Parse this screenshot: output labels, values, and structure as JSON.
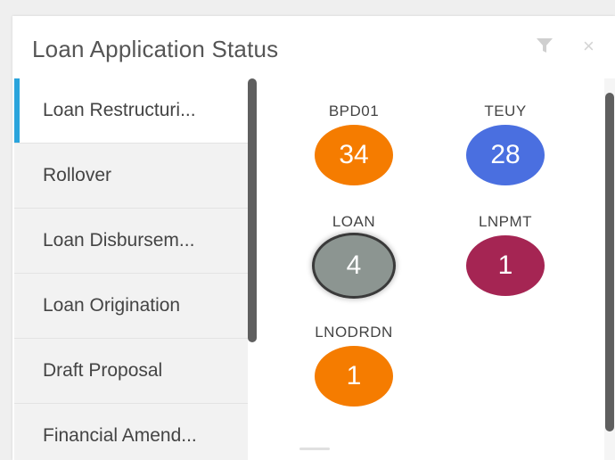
{
  "widget": {
    "title": "Loan Application Status",
    "filter_icon": "filter-icon",
    "close_icon": "close-icon",
    "close_glyph": "×"
  },
  "sidebar": {
    "items": [
      {
        "label": "Loan Restructuri...",
        "active": true
      },
      {
        "label": "Rollover",
        "active": false
      },
      {
        "label": "Loan Disbursem...",
        "active": false
      },
      {
        "label": "Loan Origination",
        "active": false
      },
      {
        "label": "Draft Proposal",
        "active": false
      },
      {
        "label": "Financial Amend...",
        "active": false
      }
    ]
  },
  "tiles": [
    {
      "code": "BPD01",
      "count": "34",
      "color": "#f57c00"
    },
    {
      "code": "TEUY",
      "count": "28",
      "color": "#4a6fe0"
    },
    {
      "code": "LOAN",
      "count": "4",
      "color": "#8c9591",
      "selected": true
    },
    {
      "code": "LNPMT",
      "count": "1",
      "color": "#a52553"
    },
    {
      "code": "LNODRDN",
      "count": "1",
      "color": "#f57c00"
    }
  ],
  "colors": {
    "accent": "#2aa4dc",
    "scrollbar": "#5f5f5f"
  }
}
